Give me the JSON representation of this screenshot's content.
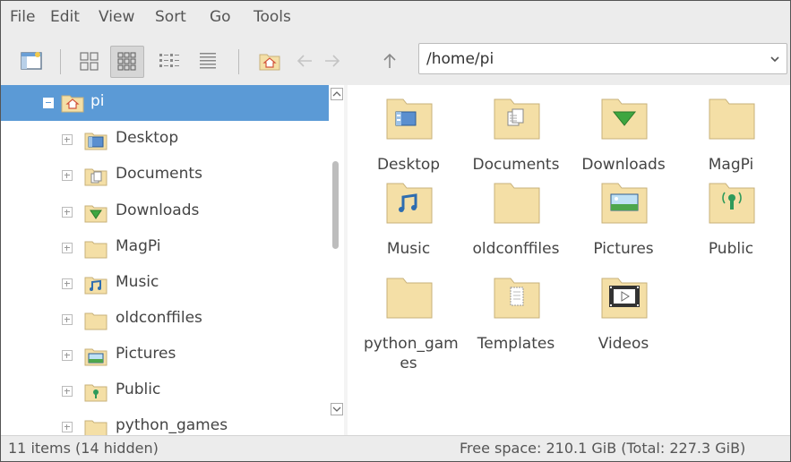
{
  "menu": [
    "File",
    "Edit",
    "View",
    "Sort",
    "Go",
    "Tools"
  ],
  "path": "/home/pi",
  "tree": {
    "root": "pi",
    "items": [
      "Desktop",
      "Documents",
      "Downloads",
      "MagPi",
      "Music",
      "oldconffiles",
      "Pictures",
      "Public",
      "python_games"
    ]
  },
  "files": [
    {
      "label": "Desktop",
      "icon": "desktop-folder-icon"
    },
    {
      "label": "Documents",
      "icon": "documents-folder-icon"
    },
    {
      "label": "Downloads",
      "icon": "downloads-folder-icon"
    },
    {
      "label": "MagPi",
      "icon": "folder-icon"
    },
    {
      "label": "Music",
      "icon": "music-folder-icon"
    },
    {
      "label": "oldconffiles",
      "icon": "folder-icon"
    },
    {
      "label": "Pictures",
      "icon": "pictures-folder-icon"
    },
    {
      "label": "Public",
      "icon": "public-folder-icon"
    },
    {
      "label": "python_gam es",
      "icon": "folder-icon"
    },
    {
      "label": "Templates",
      "icon": "templates-folder-icon"
    },
    {
      "label": "Videos",
      "icon": "videos-folder-icon"
    }
  ],
  "status": {
    "items": "11 items (14 hidden)",
    "free": "Free space: 210.1 GiB (Total: 227.3 GiB)"
  },
  "colors": {
    "selection": "#5b9ad6",
    "folder": "#f4dfa6",
    "folder_edge": "#c7b07a"
  }
}
